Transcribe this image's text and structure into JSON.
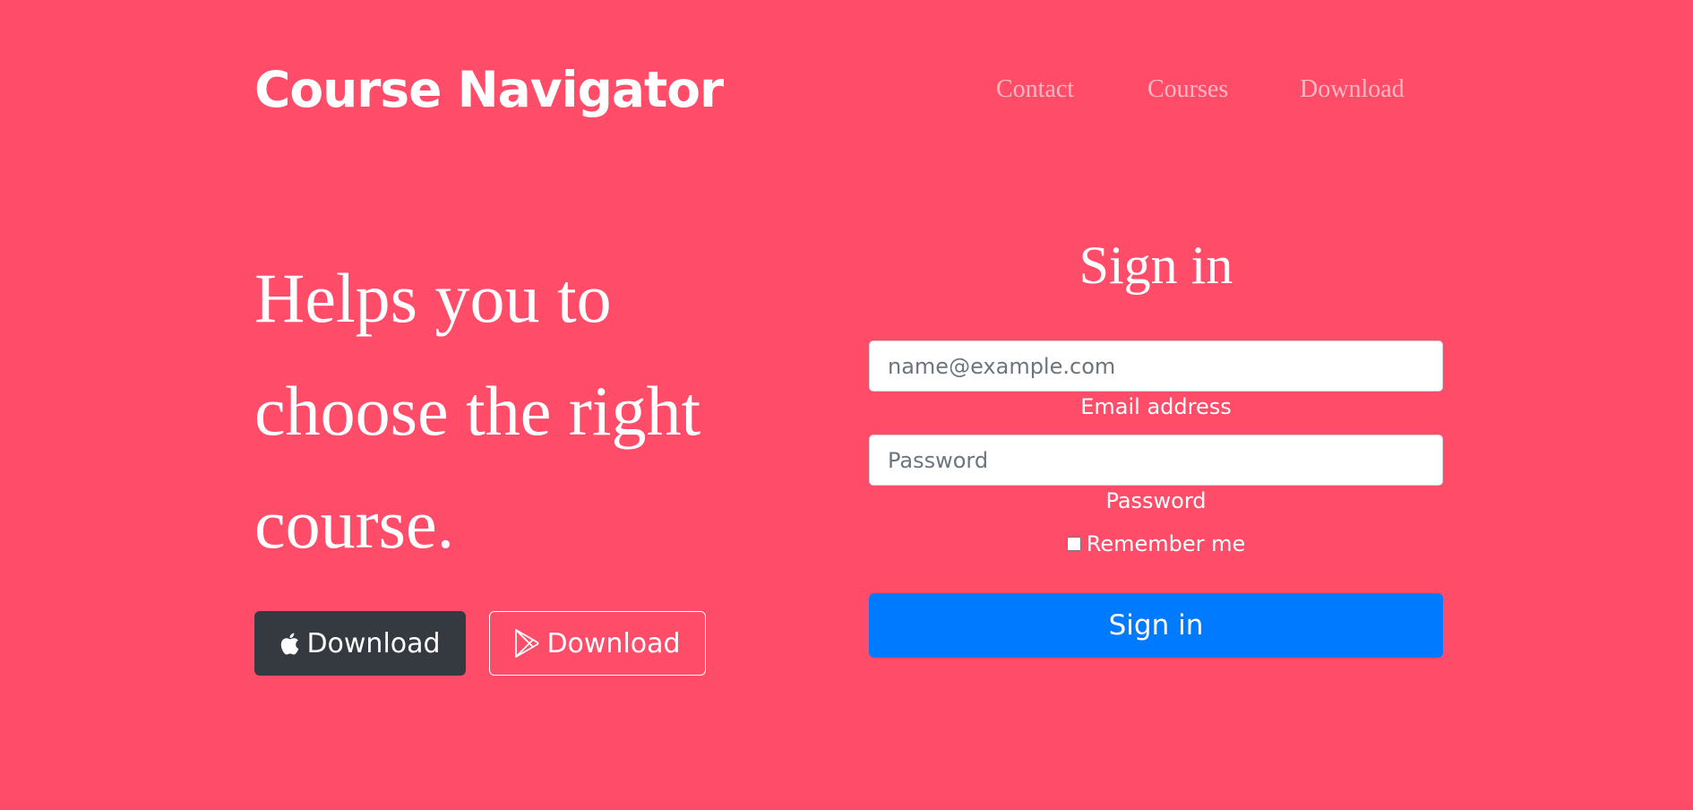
{
  "brand": "Course Navigator",
  "nav": {
    "items": [
      {
        "label": "Contact"
      },
      {
        "label": "Courses"
      },
      {
        "label": "Download"
      }
    ]
  },
  "hero": {
    "line1": "Helps you to",
    "line2": "choose the right",
    "line3": "course."
  },
  "downloads": {
    "apple_label": "Download",
    "play_label": "Download",
    "apple_icon": "apple-icon",
    "play_icon": "google-play-icon"
  },
  "signin": {
    "title": "Sign in",
    "email_placeholder": "name@example.com",
    "email_label": "Email address",
    "password_placeholder": "Password",
    "password_label": "Password",
    "remember_label": "Remember me",
    "submit_label": "Sign in"
  },
  "colors": {
    "background": "#ff4c68",
    "nav_link": "#ffb8c3",
    "apple_button": "#343a40",
    "submit_button": "#007bff"
  }
}
